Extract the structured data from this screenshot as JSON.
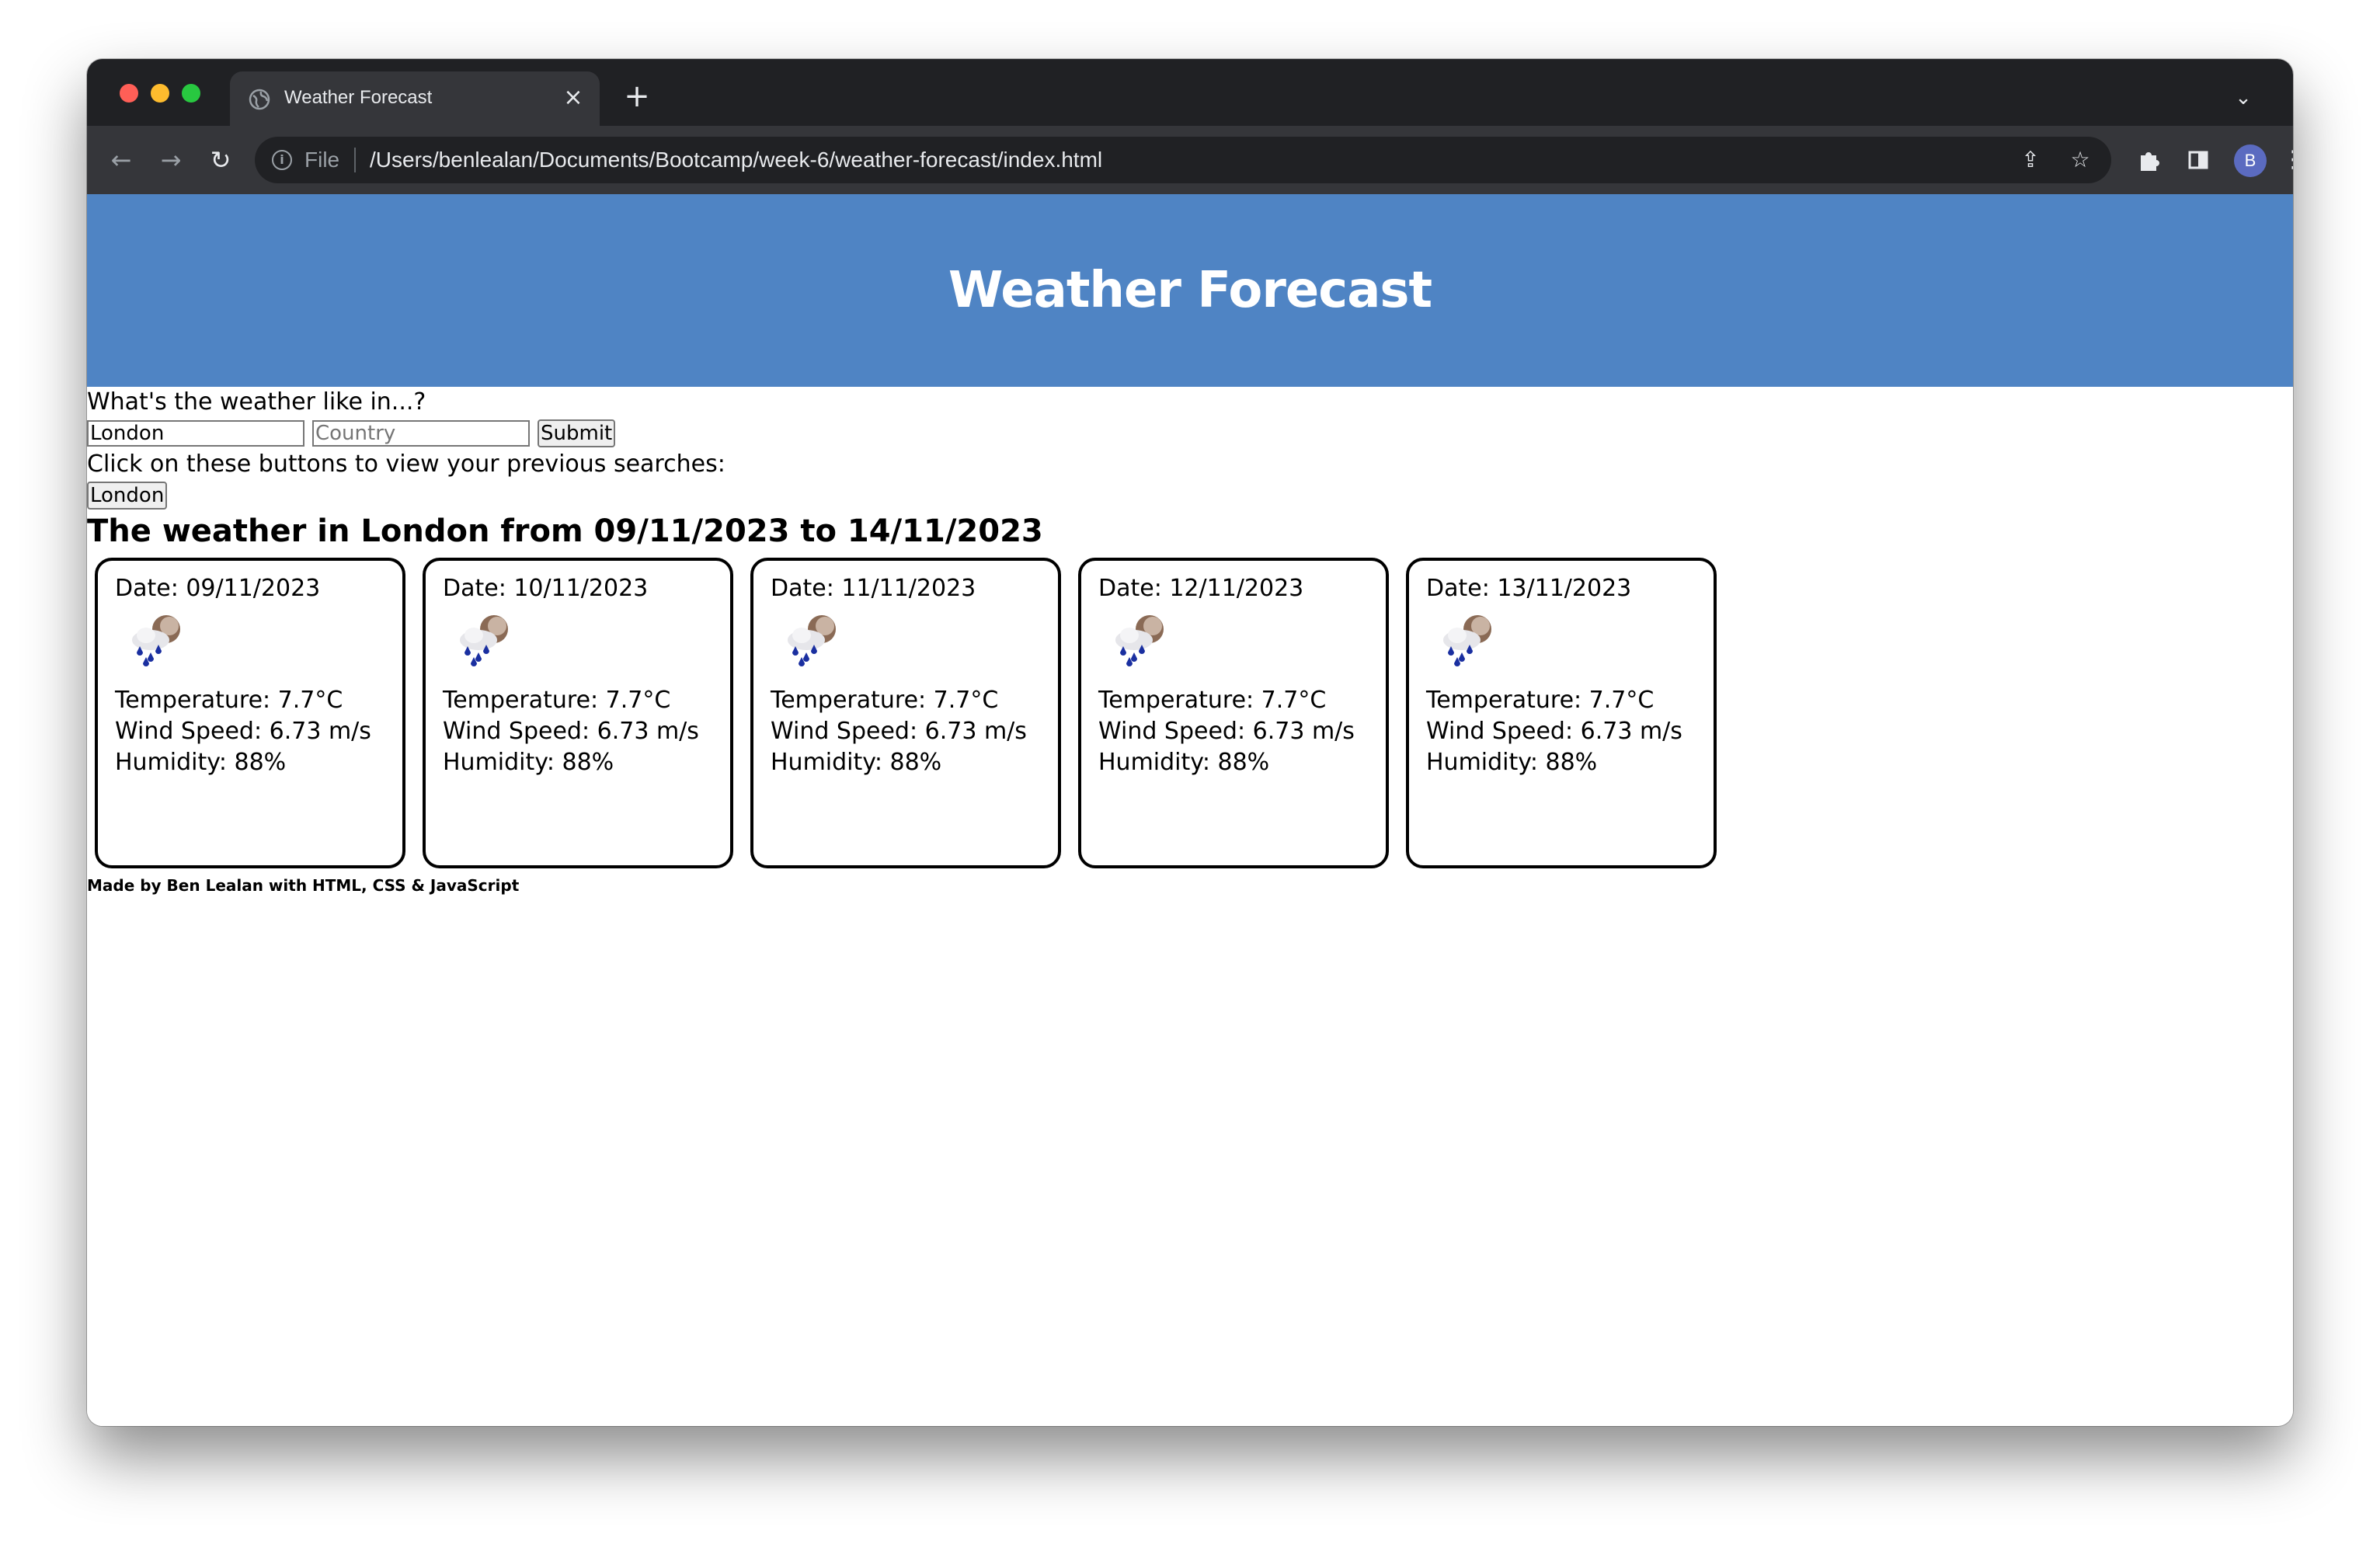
{
  "browser": {
    "tab_title": "Weather Forecast",
    "file_label": "File",
    "url": "/Users/benlealan/Documents/Bootcamp/week-6/weather-forecast/index.html",
    "avatar_initial": "B"
  },
  "page": {
    "header_title": "Weather Forecast",
    "prompt": "What's the weather like in...?",
    "city_value": "London",
    "country_placeholder": "Country",
    "submit_label": "Submit",
    "history_prompt": "Click on these buttons to view your previous searches:",
    "history": [
      "London"
    ],
    "results_title": "The weather in London from 09/11/2023 to 14/11/2023",
    "footer": "Made by Ben Lealan with HTML, CSS & JavaScript"
  },
  "forecast": [
    {
      "date": "Date: 09/11/2023",
      "icon": "rain-cloud-icon",
      "temperature": "Temperature: 7.7°C",
      "wind": "Wind Speed: 6.73 m/s",
      "humidity": "Humidity: 88%"
    },
    {
      "date": "Date: 10/11/2023",
      "icon": "rain-cloud-icon",
      "temperature": "Temperature: 7.7°C",
      "wind": "Wind Speed: 6.73 m/s",
      "humidity": "Humidity: 88%"
    },
    {
      "date": "Date: 11/11/2023",
      "icon": "rain-cloud-icon",
      "temperature": "Temperature: 7.7°C",
      "wind": "Wind Speed: 6.73 m/s",
      "humidity": "Humidity: 88%"
    },
    {
      "date": "Date: 12/11/2023",
      "icon": "rain-cloud-icon",
      "temperature": "Temperature: 7.7°C",
      "wind": "Wind Speed: 6.73 m/s",
      "humidity": "Humidity: 88%"
    },
    {
      "date": "Date: 13/11/2023",
      "icon": "rain-cloud-icon",
      "temperature": "Temperature: 7.7°C",
      "wind": "Wind Speed: 6.73 m/s",
      "humidity": "Humidity: 88%"
    }
  ],
  "colors": {
    "header_bg": "#4f84c4",
    "browser_frame": "#202124",
    "browser_toolbar": "#35363a"
  }
}
